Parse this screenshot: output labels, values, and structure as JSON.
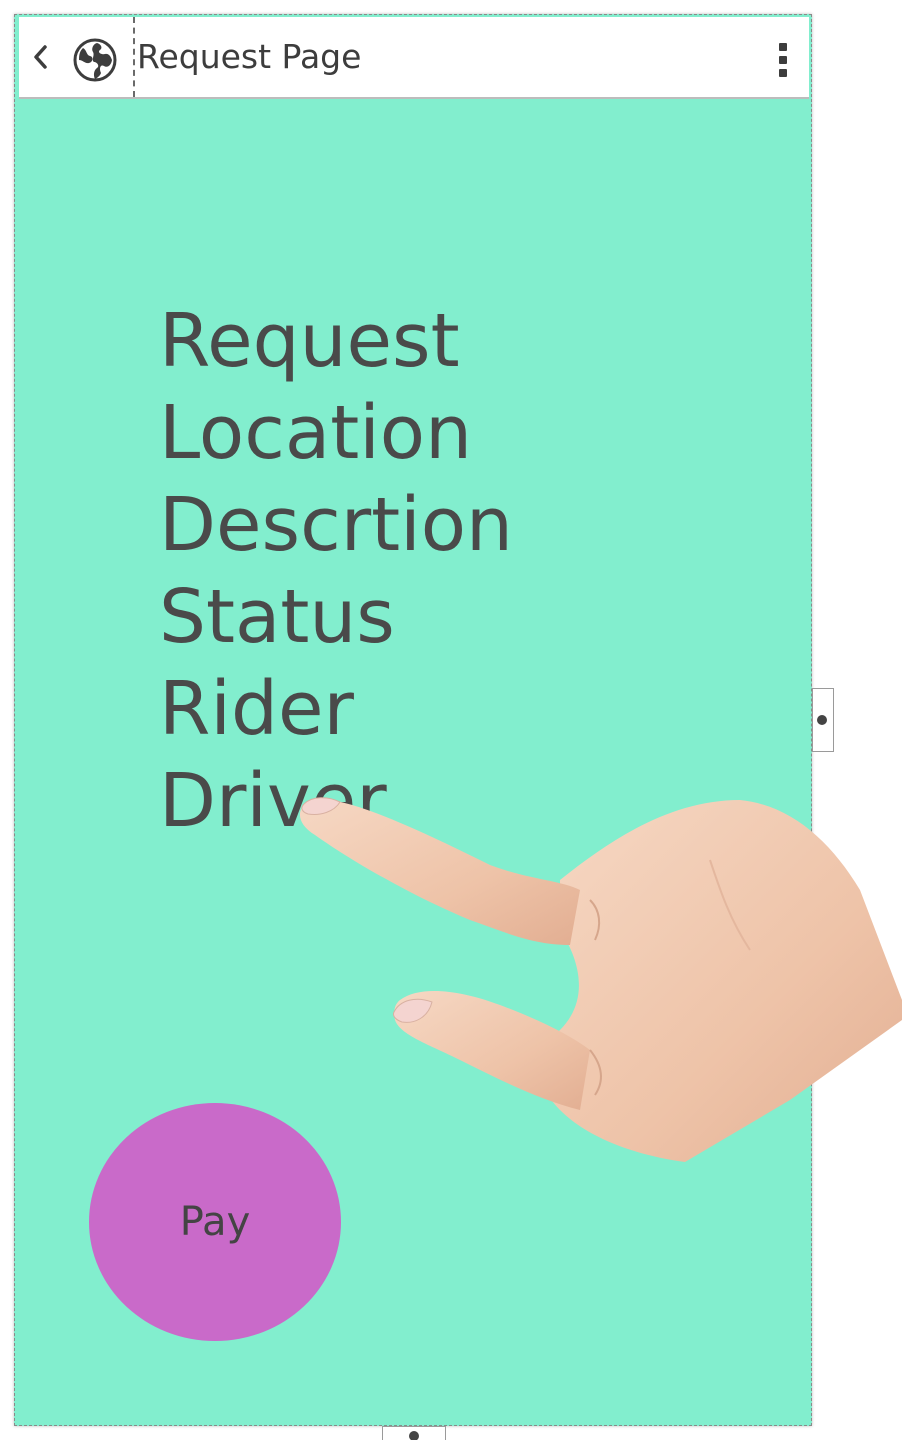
{
  "header": {
    "back_icon": "chevron-left-icon",
    "globe_icon": "globe-icon",
    "title": "Request Page",
    "menu_icon": "vertical-dots-icon"
  },
  "content": {
    "fields": [
      "Request",
      "Location",
      "Descrtion",
      "Status",
      "Rider",
      "Driver"
    ]
  },
  "pay_button": {
    "label": "Pay"
  },
  "overlay": {
    "pointer": "hand-pointer-icon"
  },
  "colors": {
    "screen_background": "#82eece",
    "pay_button": "#c96ac9",
    "text": "#4a4a4a",
    "topbar": "#ffffff"
  }
}
